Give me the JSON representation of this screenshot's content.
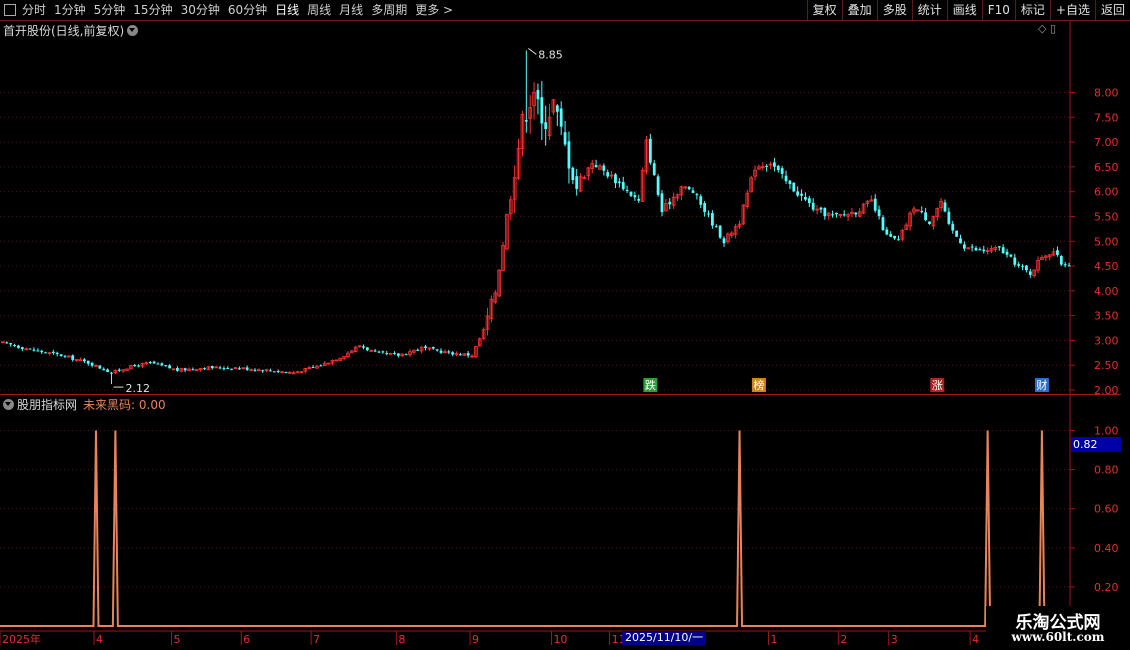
{
  "toolbar": {
    "timeframes": [
      "分时",
      "1分钟",
      "5分钟",
      "15分钟",
      "30分钟",
      "60分钟",
      "日线",
      "周线",
      "月线",
      "多周期",
      "更多 >"
    ],
    "active_timeframe": "日线",
    "buttons": [
      "复权",
      "叠加",
      "多股",
      "统计",
      "画线",
      "F10",
      "标记",
      "+自选",
      "返回"
    ]
  },
  "main_pane": {
    "title": "首开股份(日线,前复权)",
    "high_label": "8.85",
    "low_label": "2.12",
    "event_markers": [
      {
        "text": "跌",
        "color": "#2e9e3a",
        "index": 167
      },
      {
        "text": "榜",
        "color": "#d2811e",
        "index": 195
      },
      {
        "text": "涨",
        "color": "#b02222",
        "index": 241
      },
      {
        "text": "财",
        "color": "#2a6fc8",
        "index": 268
      }
    ]
  },
  "indicator": {
    "name": "股朋指标网",
    "series_label": "未来黑码: 0.00",
    "current_value": "0.82"
  },
  "x_axis": {
    "labels": [
      {
        "text": "2025年",
        "index": 0
      },
      {
        "text": "4",
        "index": 24
      },
      {
        "text": "5",
        "index": 44
      },
      {
        "text": "6",
        "index": 62
      },
      {
        "text": "7",
        "index": 80
      },
      {
        "text": "8",
        "index": 102
      },
      {
        "text": "9",
        "index": 121
      },
      {
        "text": "10",
        "index": 142
      },
      {
        "text": "11",
        "index": 157
      },
      {
        "text": "1",
        "index": 198
      },
      {
        "text": "2",
        "index": 216
      },
      {
        "text": "3",
        "index": 229
      },
      {
        "text": "4",
        "index": 250
      }
    ],
    "cursor_date": "2025/11/10/一"
  },
  "watermark": {
    "title": "乐淘公式网",
    "url": "www.60lt.com"
  },
  "colors": {
    "up": "#ff3232",
    "down": "#54ffff",
    "grid": "#5a1010",
    "indicator_line": "#e8845a",
    "axis_text": "#e03030"
  },
  "chart_data": [
    {
      "type": "candlestick",
      "title": "首开股份(日线,前复权)",
      "ylim": [
        1.9,
        9.2
      ],
      "yticks": [
        2.0,
        2.5,
        3.0,
        3.5,
        4.0,
        4.5,
        5.0,
        5.5,
        6.0,
        6.5,
        7.0,
        7.5,
        8.0
      ],
      "anchors": [
        [
          0,
          2.95
        ],
        [
          8,
          2.8
        ],
        [
          15,
          2.7
        ],
        [
          22,
          2.55
        ],
        [
          28,
          2.35
        ],
        [
          32,
          2.45
        ],
        [
          38,
          2.55
        ],
        [
          45,
          2.4
        ],
        [
          52,
          2.45
        ],
        [
          60,
          2.45
        ],
        [
          68,
          2.4
        ],
        [
          75,
          2.35
        ],
        [
          82,
          2.5
        ],
        [
          88,
          2.7
        ],
        [
          92,
          2.9
        ],
        [
          96,
          2.75
        ],
        [
          102,
          2.7
        ],
        [
          108,
          2.85
        ],
        [
          115,
          2.75
        ],
        [
          121,
          2.7
        ],
        [
          124,
          3.2
        ],
        [
          127,
          4.0
        ],
        [
          129,
          5.0
        ],
        [
          131,
          6.0
        ],
        [
          134,
          7.4
        ],
        [
          137,
          8.1
        ],
        [
          139,
          7.3
        ],
        [
          142,
          7.8
        ],
        [
          145,
          6.9
        ],
        [
          148,
          6.1
        ],
        [
          152,
          6.6
        ],
        [
          157,
          6.3
        ],
        [
          160,
          6.1
        ],
        [
          164,
          5.8
        ],
        [
          166,
          7.0
        ],
        [
          170,
          5.6
        ],
        [
          175,
          6.1
        ],
        [
          178,
          6.0
        ],
        [
          182,
          5.5
        ],
        [
          186,
          5.0
        ],
        [
          190,
          5.4
        ],
        [
          194,
          6.5
        ],
        [
          198,
          6.6
        ],
        [
          202,
          6.2
        ],
        [
          206,
          5.9
        ],
        [
          210,
          5.6
        ],
        [
          215,
          5.5
        ],
        [
          220,
          5.6
        ],
        [
          224,
          5.8
        ],
        [
          228,
          5.1
        ],
        [
          231,
          5.0
        ],
        [
          235,
          5.7
        ],
        [
          239,
          5.4
        ],
        [
          242,
          5.8
        ],
        [
          244,
          5.3
        ],
        [
          248,
          4.9
        ],
        [
          252,
          4.8
        ],
        [
          257,
          4.85
        ],
        [
          262,
          4.5
        ],
        [
          265,
          4.35
        ],
        [
          268,
          4.7
        ],
        [
          271,
          4.8
        ],
        [
          273,
          4.55
        ]
      ],
      "high": 8.85,
      "low": 2.12
    },
    {
      "type": "line",
      "name": "未来黑码",
      "ylim": [
        0,
        1.1
      ],
      "yticks": [
        0.2,
        0.4,
        0.6,
        0.8,
        1.0
      ],
      "baseline": 0,
      "spikes": [
        {
          "index": 24,
          "value": 1.0
        },
        {
          "index": 29,
          "value": 1.0
        },
        {
          "index": 190,
          "value": 1.0
        },
        {
          "index": 254,
          "value": 1.0
        },
        {
          "index": 268,
          "value": 1.0
        }
      ]
    }
  ]
}
